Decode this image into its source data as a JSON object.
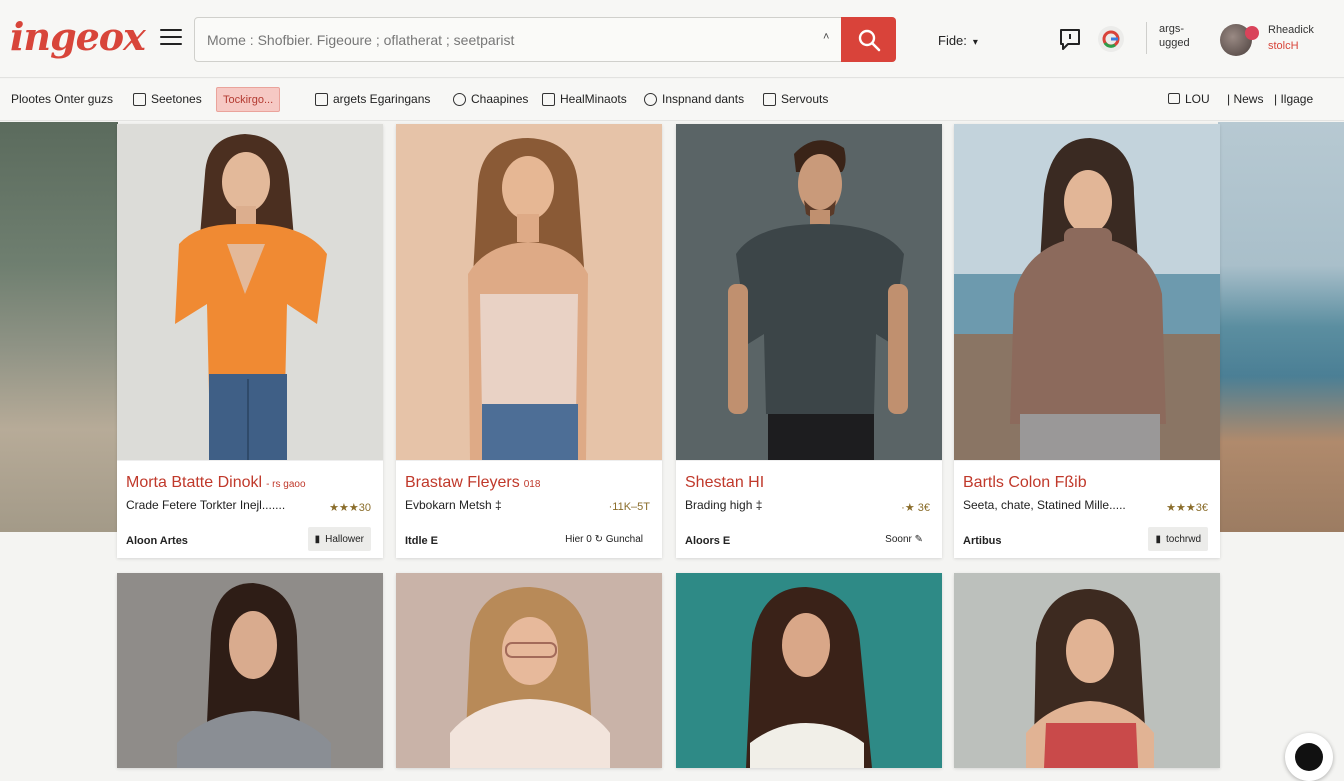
{
  "header": {
    "logo": "ingeox",
    "search_text": "Mome : Shofbier. Figeoure  ;  oflatherat  ;  seetparist",
    "filter_label": "Fide:",
    "account_line1": "args-",
    "account_line2": "ugged",
    "user_name": "Rheadick",
    "user_sub": "stolcH"
  },
  "nav": {
    "items": [
      {
        "label": "Plootes Onter guzs"
      },
      {
        "label": "Seetones"
      },
      {
        "label": "Tockirgo..."
      },
      {
        "label": "argets Egaringans"
      },
      {
        "label": "Chaapines"
      },
      {
        "label": "HealMinaots"
      },
      {
        "label": "Inspnand dants"
      },
      {
        "label": "Servouts"
      }
    ],
    "right": [
      {
        "label": "LOU"
      },
      {
        "label": "| News"
      },
      {
        "label": "| Ilgage"
      }
    ]
  },
  "cards": [
    {
      "title": "Morta Btatte Dinokl",
      "title_small": "- rs gaoo",
      "desc": "Crade Fetere Torkter Inejl.......",
      "rating": "★★★30",
      "author": "Aloon Artes",
      "action": "Hallower"
    },
    {
      "title": "Brastaw Fleyers",
      "title_small": "018",
      "desc": "Evbokarn Metsh ‡",
      "rating": "·11K–5T",
      "author": "Itdle E",
      "action": "Hier 0  ↻ Gunchal"
    },
    {
      "title": "Shestan HI",
      "title_small": "",
      "desc": "Brading high ‡",
      "rating": "·★ 3€",
      "author": "Aloors E",
      "action": "Soonr ✎"
    },
    {
      "title": "Bartls Colon Fßib",
      "title_small": "",
      "desc": "Seeta, chate, Statined Mille.....",
      "rating": "★★★3€",
      "author": "Artibus",
      "action": "tochrwd"
    }
  ],
  "colors": {
    "brand": "#d8453a",
    "search_button": "#d9433a",
    "active_tab_bg": "#f6c9c4"
  }
}
